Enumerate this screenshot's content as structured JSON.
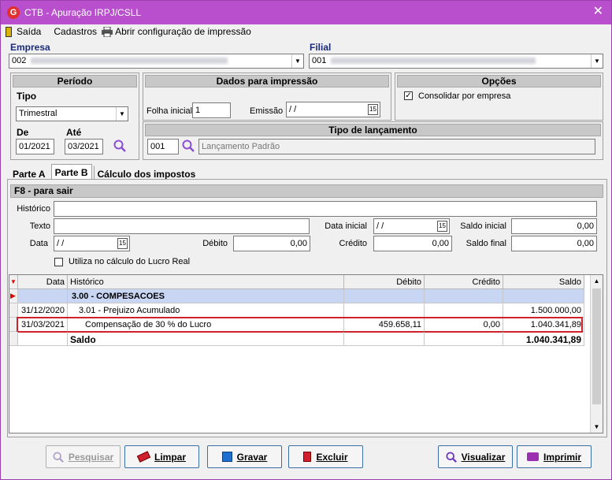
{
  "window": {
    "title": "CTB - Apuração IRPJ/CSLL",
    "app_icon": "G"
  },
  "menu": [
    {
      "label": "Saída",
      "icon": "exit-door-icon"
    },
    {
      "label": "Cadastros"
    },
    {
      "label": "Abrir configuração de impressão",
      "icon": "printer-icon"
    }
  ],
  "empresa": {
    "label": "Empresa",
    "value": "002"
  },
  "filial": {
    "label": "Filial",
    "value": "001"
  },
  "periodo": {
    "title": "Período",
    "tipo_label": "Tipo",
    "tipo_value": "Trimestral",
    "de_label": "De",
    "de_value": "01/2021",
    "ate_label": "Até",
    "ate_value": "03/2021"
  },
  "impressao": {
    "title": "Dados para impressão",
    "folha_label": "Folha inicial",
    "folha_value": "1",
    "emissao_label": "Emissão",
    "emissao_value": " /  /"
  },
  "opcoes": {
    "title": "Opções",
    "consolidar_label": "Consolidar por empresa",
    "consolidar_checked": true
  },
  "lancamento": {
    "title": "Tipo de lançamento",
    "code": "001",
    "desc": "Lançamento Padrão"
  },
  "tabs": [
    "Parte A",
    "Parte B",
    "Cálculo dos impostos"
  ],
  "active_tab": "Parte B",
  "form": {
    "f8": "F8 - para sair",
    "historico_label": "Histórico",
    "historico_value": "",
    "texto_label": "Texto",
    "texto_value": "",
    "data_inicial_label": "Data inicial",
    "data_inicial_value": " /  /",
    "saldo_inicial_label": "Saldo inicial",
    "saldo_inicial_value": "0,00",
    "data_label": "Data",
    "data_value": " /  /",
    "debito_label": "Débito",
    "debito_value": "0,00",
    "credito_label": "Crédito",
    "credito_value": "0,00",
    "saldo_final_label": "Saldo final",
    "saldo_final_value": "0,00",
    "lucro_real_label": "Utiliza no cálculo do Lucro Real"
  },
  "grid": {
    "headers": {
      "data": "Data",
      "historico": "Histórico",
      "debito": "Débito",
      "credito": "Crédito",
      "saldo": "Saldo"
    },
    "rows": [
      {
        "data": "",
        "historico": "3.00 - COMPESACOES",
        "debito": "",
        "credito": "",
        "saldo": ""
      },
      {
        "data": "31/12/2020",
        "historico": "3.01 - Prejuizo Acumulado",
        "debito": "",
        "credito": "",
        "saldo": "1.500.000,00"
      },
      {
        "data": "31/03/2021",
        "historico": "Compensação de 30 % do Lucro",
        "debito": "459.658,11",
        "credito": "0,00",
        "saldo": "1.040.341,89"
      },
      {
        "data": "",
        "historico": "Saldo",
        "debito": "",
        "credito": "",
        "saldo": "1.040.341,89"
      }
    ]
  },
  "buttons": {
    "pesquisar": "Pesquisar",
    "limpar": "Limpar",
    "gravar": "Gravar",
    "excluir": "Excluir",
    "visualizar": "Visualizar",
    "imprimir": "Imprimir"
  },
  "colors": {
    "titlebar": "#b94fcc",
    "highlight": "#c8d6f4",
    "selection_border": "#d0202a",
    "label_blue": "#1a2a7a"
  }
}
